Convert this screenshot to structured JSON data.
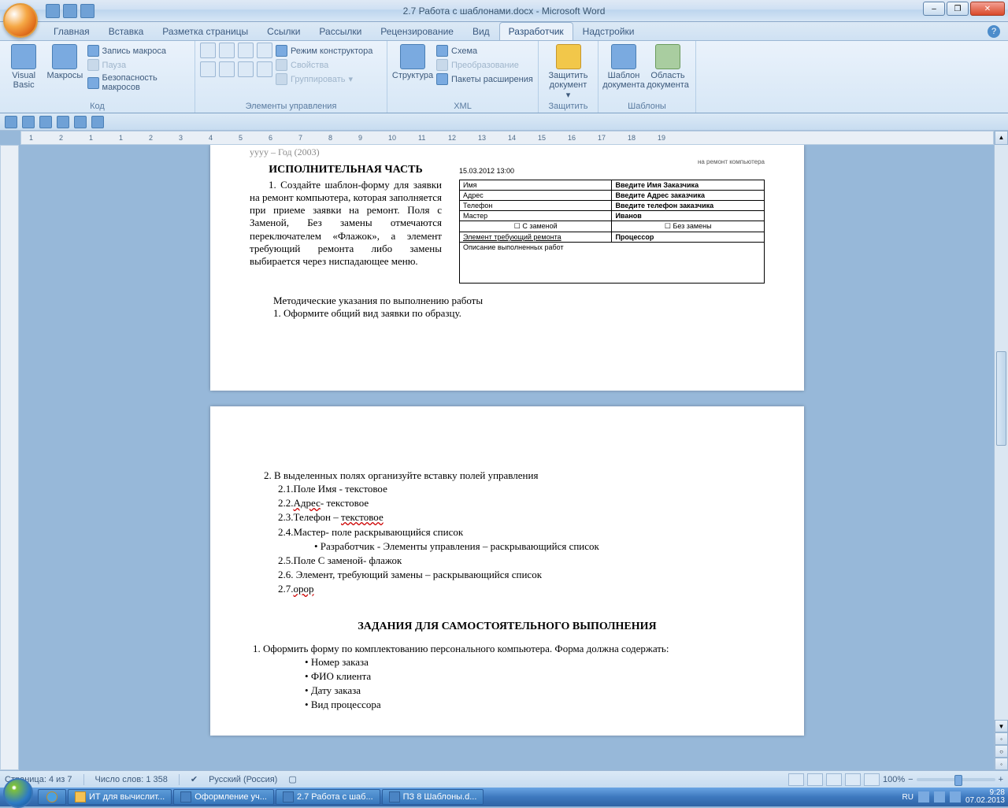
{
  "window": {
    "title": "2.7 Работа с шаблонами.docx - Microsoft Word",
    "minimize": "–",
    "restore": "❐",
    "close": "✕"
  },
  "tabs": [
    "Главная",
    "Вставка",
    "Разметка страницы",
    "Ссылки",
    "Рассылки",
    "Рецензирование",
    "Вид",
    "Разработчик",
    "Надстройки"
  ],
  "active_tab": 7,
  "ribbon": {
    "code": {
      "vb": "Visual\nBasic",
      "macros": "Макросы",
      "rec": "Запись макроса",
      "pause": "Пауза",
      "sec": "Безопасность макросов",
      "label": "Код"
    },
    "controls": {
      "design": "Режим конструктора",
      "props": "Свойства",
      "group": "Группировать",
      "label": "Элементы управления"
    },
    "xml": {
      "struct": "Структура",
      "schema": "Схема",
      "transform": "Преобразование",
      "packs": "Пакеты расширения",
      "label": "XML"
    },
    "protect": {
      "btn": "Защитить\nдокумент",
      "label": "Защитить"
    },
    "templates": {
      "tpl": "Шаблон\nдокумента",
      "area": "Область\nдокумента",
      "label": "Шаблоны"
    }
  },
  "ruler_numbers": [
    "1",
    "2",
    "1",
    "1",
    "2",
    "3",
    "4",
    "5",
    "6",
    "7",
    "8",
    "9",
    "10",
    "11",
    "12",
    "13",
    "14",
    "15",
    "16",
    "17",
    "18",
    "19"
  ],
  "doc": {
    "yyyy": "yyyy – Год (2003)",
    "h1": "ИСПОЛНИТЕЛЬНАЯ ЧАСТЬ",
    "p1": "1. Создайте шаблон-форму для заявки на ремонт компьютера, которая заполняется при приеме заявки на ремонт. Поля с Заменой, Без замены отмечаются переключателем «Флажок», а элемент требующий ремонта либо замены выбирается через ниспадающее меню.",
    "form": {
      "datetime": "15.03.2012 13:00",
      "rows": [
        [
          "Имя",
          "Введите Имя Заказчика"
        ],
        [
          "Адрес",
          "Введите Адрес заказчика"
        ],
        [
          "Телефон",
          "Введите телефон заказчика"
        ],
        [
          "Мастер",
          "Иванов"
        ]
      ],
      "chk1": "С заменой",
      "chk2": "Без замены",
      "elem_l": "Элемент требующий ремонта",
      "elem_r": "Процессор",
      "desc": "Описание выполненных работ"
    },
    "met_h": "Методические указания по выполнению работы",
    "met_1": "1. Оформите общий вид заявки по образцу.",
    "pg2_lead": "2. В выделенных полях организуйте вставку полей управления",
    "pg2": [
      "2.1.Поле Имя - текстовое",
      "2.2.Адрес- текстовое",
      "2.3.Телефон – текстовое",
      "2.4.Мастер- поле раскрывающийся список"
    ],
    "pg2_sub": "• Разработчик - Элементы управления – раскрывающийся список",
    "pg2b": [
      "2.5.Поле С заменой- флажок",
      "2.6. Элемент, требующий замены – раскрывающийся список",
      "2.7.орор"
    ],
    "h2": "ЗАДАНИЯ ДЛЯ САМОСТОЯТЕЛЬНОГО ВЫПОЛНЕНИЯ",
    "task1": "1. Оформить форму по комплектованию персонального компьютера. Форма должна содержать:",
    "bullets": [
      "Номер заказа",
      "ФИО клиента",
      "Дату заказа",
      "Вид процессора"
    ]
  },
  "status": {
    "page": "Страница: 4 из 7",
    "words": "Число слов: 1 358",
    "lang": "Русский (Россия)",
    "zoom": "100%"
  },
  "taskbar": {
    "items": [
      "ИТ для вычислит...",
      "Оформление уч...",
      "2.7 Работа с шаб...",
      "ПЗ 8 Шаблоны.d..."
    ],
    "lang": "RU",
    "time": "9:28",
    "date": "07.02.2013"
  }
}
